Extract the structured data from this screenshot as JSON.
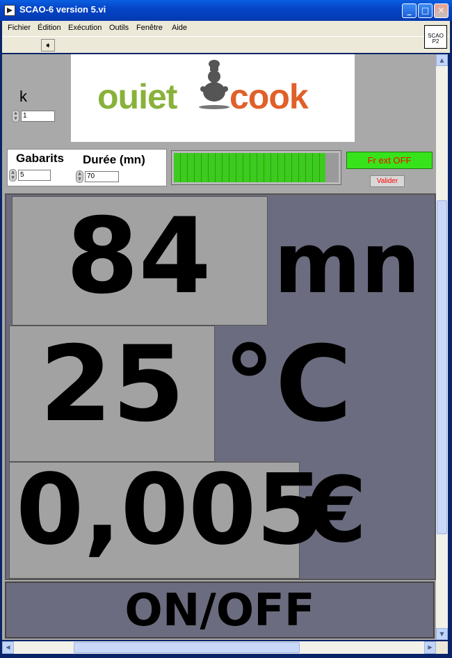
{
  "window": {
    "title": "SCAO-6 version 5.vi",
    "buttons": {
      "minimize": "_",
      "maximize": "□",
      "close": "✕"
    }
  },
  "menu": {
    "items": [
      "Fichier",
      "Édition",
      "Exécution",
      "Outils",
      "Fenêtre",
      "Aide"
    ]
  },
  "toolbar": {
    "run_icon": "run-arrow-icon"
  },
  "vi_icon": {
    "line1": "SCAO",
    "line2": "P2"
  },
  "panel": {
    "k": {
      "label": "k",
      "value": "1"
    },
    "logo": {
      "left": "uiet",
      "right": "cook",
      "q_letter": "o"
    },
    "gabarits": {
      "label": "Gabarits",
      "value": "5"
    },
    "duree": {
      "label": "Durée (mn)",
      "value": "70"
    },
    "progress": {
      "fraction": 0.92,
      "color": "#3ccb1e"
    },
    "fr_ext_button": "Fr ext OFF",
    "valider_button": "Valider",
    "time": {
      "value": "84",
      "unit": "mn"
    },
    "temperature": {
      "value": "25",
      "unit": "°C"
    },
    "cost": {
      "value": "0,005",
      "unit": "€"
    },
    "onoff_button": "ON/OFF"
  },
  "colors": {
    "panel_bg": "#a9a9a9",
    "display_bg": "#6c6c80",
    "fr_ext_bg": "#37e31b",
    "fr_ext_text": "#ff0000",
    "logo_green": "#88b23a",
    "logo_orange": "#e0602a"
  }
}
